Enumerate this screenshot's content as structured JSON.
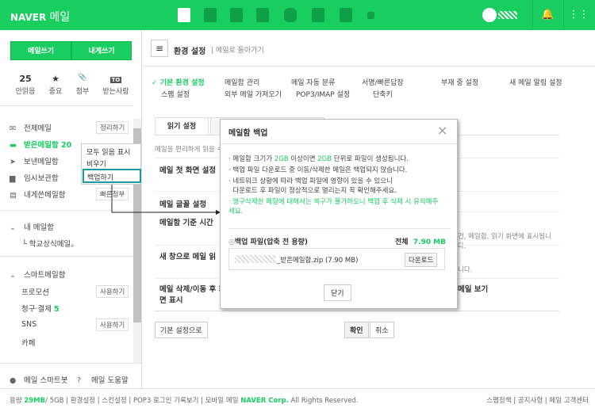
{
  "header": {
    "logo_brand": "NAVER",
    "logo_product": "메일",
    "apps": [
      "mail-icon",
      "calendar-icon",
      "list-icon",
      "contacts-icon",
      "cube-icon",
      "office-icon",
      "works-icon",
      "more-icon"
    ],
    "accent": "#19ce60"
  },
  "sidebar": {
    "write_label": "메일쓰기",
    "self_write_label": "내게쓰기",
    "stats": [
      {
        "value": "25",
        "label": "안읽음"
      },
      {
        "value": "★",
        "label": "중요"
      },
      {
        "value": "📎",
        "label": "첨부"
      },
      {
        "value": "TO",
        "label": "받는사람"
      }
    ],
    "folders": [
      {
        "label": "전체메일",
        "action": "정리하기"
      },
      {
        "label": "받은메일함",
        "count": "20"
      },
      {
        "label": "보낸메일함"
      },
      {
        "label": "임시보관함"
      },
      {
        "label": "내게쓴메일함",
        "action": "빠른첨부"
      }
    ],
    "my_mailbox": {
      "title": "내 메일함",
      "items": [
        "학교상식메일。"
      ]
    },
    "smart": {
      "title": "스마트메일함",
      "items": [
        {
          "label": "프로모션",
          "action": "사용하기"
        },
        {
          "label": "청구·결제",
          "count": "5"
        },
        {
          "label": "SNS",
          "action": "사용하기"
        },
        {
          "label": "카페"
        }
      ]
    },
    "bottom": {
      "smartbot": "메일 스마트봇",
      "help": "메일 도움말"
    }
  },
  "context_menu": {
    "items": [
      "모두 읽음 표시",
      "비우기",
      "백업하기"
    ]
  },
  "main": {
    "title": "환경 설정",
    "back": "메일로 돌아가기",
    "nav": [
      [
        "기본 환경 설정",
        "메일함 관리",
        "메일 자동 분류",
        "서명/빠른답장",
        "부재 중 설정",
        "새 메일 알림 설정"
      ],
      [
        "스팸 설정",
        "외부 메일 가져오기",
        "POP3/IMAP 설정",
        "단축키"
      ]
    ],
    "tab": "읽기 설정",
    "desc": "메일을 편리하게 읽을 수",
    "rows": [
      "메일 첫 화면 설정",
      "메일 글꼴 설정",
      "메일함 기준 시간",
      "새 창으로 메일 읽",
      "메일 삭제/이동 후 화면 표시"
    ],
    "row_side": [
      "건, 메일함, 읽기 화면에 표시됩니다.",
      "니다.",
      "메일 보기"
    ],
    "reset": "기본 설정으로",
    "ok": "확인",
    "cancel": "취소"
  },
  "dialog": {
    "title": "메일함 백업",
    "notes": [
      "메일함 크기가 ",
      "2GB",
      " 이상이면 ",
      "2GB",
      " 단위로 파일이 생성됩니다."
    ],
    "note2": "백업 파일 다운로드 중 이동/삭제한 메일은 백업되지 않습니다.",
    "note3a": "네트워크 상황에 따라 백업 파일에 영향이 있을 수 있으니",
    "note3b": "다운로드 후 파일이 정상적으로 열리는지 꼭 확인해주세요.",
    "warn": "영구삭제한 메일에 대해서는 복구가 불가하오니 백업 후 삭제 시 유의해주세요.",
    "file_header": "백업 파일(압축 전 용량)",
    "total_label": "전체",
    "total": "7.90 MB",
    "file_name": "_받은메일함.zip (7.90 MB)",
    "download": "다운로드",
    "close": "닫기"
  },
  "footer": {
    "usage_label": "용량",
    "used": "29MB",
    "quota": "/ 5GB",
    "links": [
      "환경설정",
      "스킨설정",
      "POP3 로그인 기록보기",
      "모바일 메일"
    ],
    "corp": "NAVER Corp.",
    "rights": "All Rights Reserved.",
    "right_links": [
      "스팸정책",
      "공지사항",
      "메일 고객센터"
    ]
  }
}
